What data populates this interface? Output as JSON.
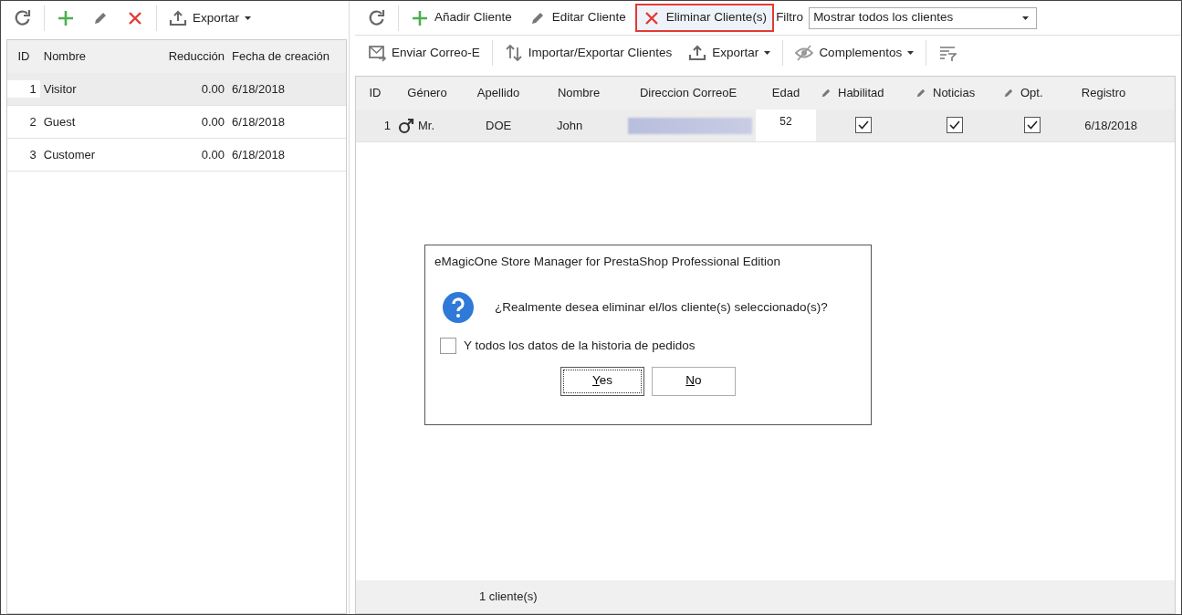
{
  "left_toolbar": {
    "items": [
      {
        "kind": "refresh"
      },
      {
        "kind": "add"
      },
      {
        "kind": "edit"
      },
      {
        "kind": "delete"
      },
      {
        "kind": "export",
        "label": "Exportar",
        "dropdown": true
      }
    ]
  },
  "groups_table": {
    "columns": [
      "ID",
      "Nombre",
      "Reducción",
      "Fecha de creación"
    ],
    "rows": [
      {
        "id": "1",
        "name": "Visitor",
        "reduction": "0.00",
        "date": "6/18/2018",
        "selected": true
      },
      {
        "id": "2",
        "name": "Guest",
        "reduction": "0.00",
        "date": "6/18/2018",
        "selected": false
      },
      {
        "id": "3",
        "name": "Customer",
        "reduction": "0.00",
        "date": "6/18/2018",
        "selected": false
      }
    ]
  },
  "toolbar": {
    "row_1": [
      {
        "kind": "refresh"
      },
      {
        "kind": "add",
        "label": "Añadir Cliente",
        "highlighted": false
      },
      {
        "kind": "edit",
        "label": "Editar Cliente",
        "highlighted": false
      },
      {
        "kind": "delete",
        "label": "Eliminar Cliente(s)",
        "highlighted": true
      }
    ],
    "filter": {
      "label": "Filtro",
      "value": "Mostrar todos los clientes"
    },
    "row_2": [
      {
        "kind": "mail",
        "label": "Enviar Correo-E",
        "dropdown": false
      },
      {
        "kind": "import",
        "label": "Importar/Exportar Clientes",
        "dropdown": false
      },
      {
        "kind": "export",
        "label": "Exportar",
        "dropdown": true
      },
      {
        "kind": "addons",
        "label": "Complementos",
        "dropdown": true
      },
      {
        "kind": "columns",
        "dropdown": false
      }
    ]
  },
  "customers_table": {
    "columns": [
      {
        "label": "ID",
        "editable": false
      },
      {
        "label": "Género",
        "editable": false
      },
      {
        "label": "Apellido",
        "editable": false
      },
      {
        "label": "Nombre",
        "editable": false
      },
      {
        "label": "Direccion CorreoE",
        "editable": false
      },
      {
        "label": "Edad",
        "editable": false
      },
      {
        "label": "Habilitad",
        "editable": true
      },
      {
        "label": "Noticias",
        "editable": true
      },
      {
        "label": "Opt.",
        "editable": true
      },
      {
        "label": "Registro",
        "editable": false
      }
    ],
    "rows": [
      {
        "id": "1",
        "gender": "Mr.",
        "last_name": "DOE",
        "first_name": "John",
        "age": "52",
        "enabled": true,
        "newsletter": true,
        "optin": true,
        "registered": "6/18/2018",
        "selected": true
      }
    ],
    "footer": "1 cliente(s)"
  },
  "dialog": {
    "title": "eMagicOne Store Manager for PrestaShop Professional Edition",
    "message": "¿Realmente desea eliminar el/los cliente(s) seleccionado(s)?",
    "checkbox": {
      "label": "Y todos los datos de la historia de pedidos",
      "checked": false
    },
    "buttons": [
      {
        "label": "Yes",
        "default": true
      },
      {
        "label": "No",
        "default": false
      }
    ]
  }
}
